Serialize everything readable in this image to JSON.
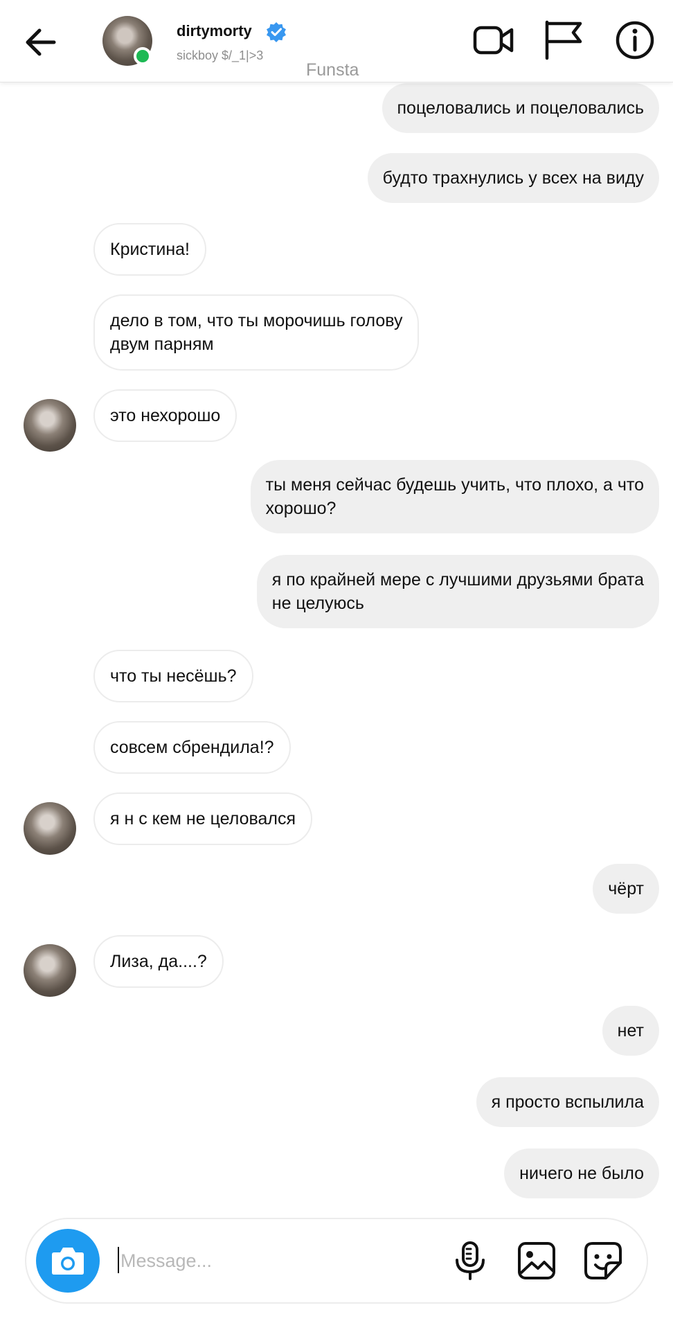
{
  "header": {
    "username": "dirtymorty",
    "subtitle": "sickboy $/_1|>3",
    "account_label": "Funsta",
    "verified": true,
    "online_color": "#1db954",
    "icons": [
      "back-arrow-icon",
      "video-call-icon",
      "flag-icon",
      "info-icon"
    ]
  },
  "messages": [
    {
      "side": "out",
      "lines": [
        "поцеловались и поцеловались"
      ]
    },
    {
      "side": "out",
      "lines": [
        "будто трахнулись у всех на виду"
      ]
    },
    {
      "side": "in",
      "lines": [
        "Кристина!"
      ]
    },
    {
      "side": "in",
      "lines": [
        "дело в том, что ты морочишь голову",
        "двум парням"
      ]
    },
    {
      "side": "in",
      "lines": [
        "это нехорошо"
      ],
      "avatar": true
    },
    {
      "side": "out",
      "lines": [
        "ты меня сейчас будешь учить, что плохо, а что",
        "хорошо?"
      ]
    },
    {
      "side": "out",
      "lines": [
        "я по крайней мере с лучшими друзьями брата",
        "не целуюсь"
      ]
    },
    {
      "side": "in",
      "lines": [
        "что ты несёшь?"
      ]
    },
    {
      "side": "in",
      "lines": [
        "совсем сбрендила!?"
      ]
    },
    {
      "side": "in",
      "lines": [
        "я н  с кем не целовался"
      ],
      "avatar": true
    },
    {
      "side": "out",
      "lines": [
        "чёрт"
      ]
    },
    {
      "side": "in",
      "lines": [
        "Лиза, да....?"
      ],
      "avatar": true
    },
    {
      "side": "out",
      "lines": [
        "нет"
      ]
    },
    {
      "side": "out",
      "lines": [
        "я просто вспылила"
      ]
    },
    {
      "side": "out",
      "lines": [
        "ничего не было"
      ]
    }
  ],
  "composer": {
    "placeholder": "Message...",
    "value": "",
    "camera_color": "#1e9bf0",
    "icons": [
      "camera-icon",
      "microphone-icon",
      "gallery-icon",
      "sticker-icon"
    ]
  }
}
